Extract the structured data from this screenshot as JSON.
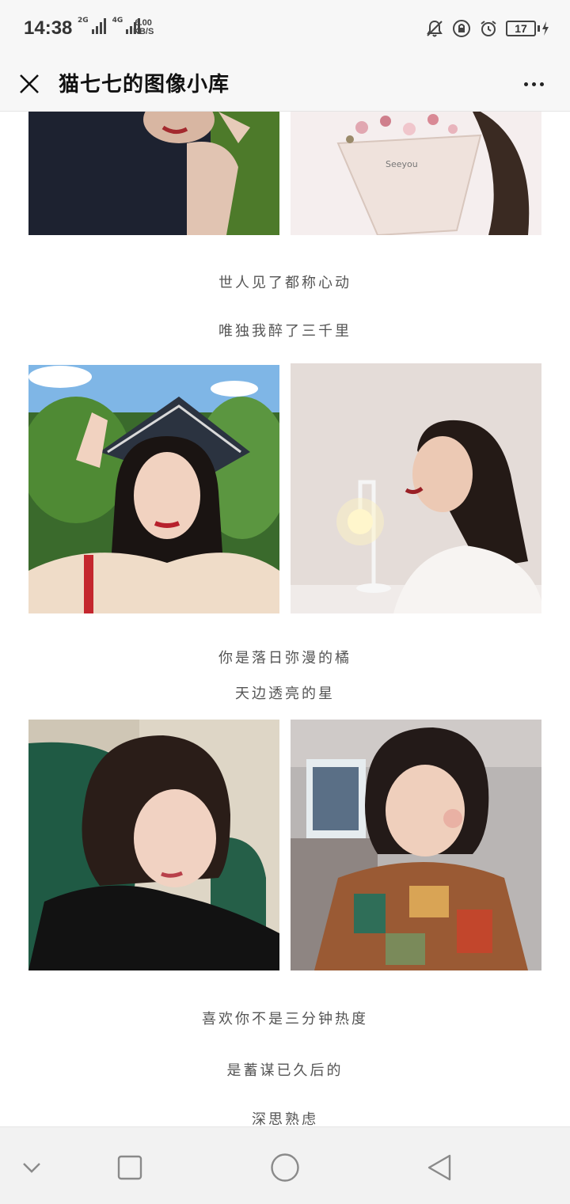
{
  "status_bar": {
    "time": "14:38",
    "sim1_label": "2G",
    "sim2_label": "4G",
    "net_speed_value": "6.00",
    "net_speed_unit": "KB/S",
    "battery_level": "17"
  },
  "header": {
    "title": "猫七七的图像小库"
  },
  "article": {
    "captions": [
      "世人见了都称心动",
      "唯独我醉了三千里",
      "你是落日弥漫的橘",
      "天边透亮的星",
      "喜欢你不是三分钟热度",
      "是蓄谋已久后的",
      "深思熟虑"
    ]
  },
  "icons": {
    "close": "close-icon",
    "more": "more-icon",
    "back": "triangle-back-icon",
    "home": "circle-home-icon",
    "recents": "square-recents-icon",
    "collapse": "chevron-down-icon"
  }
}
